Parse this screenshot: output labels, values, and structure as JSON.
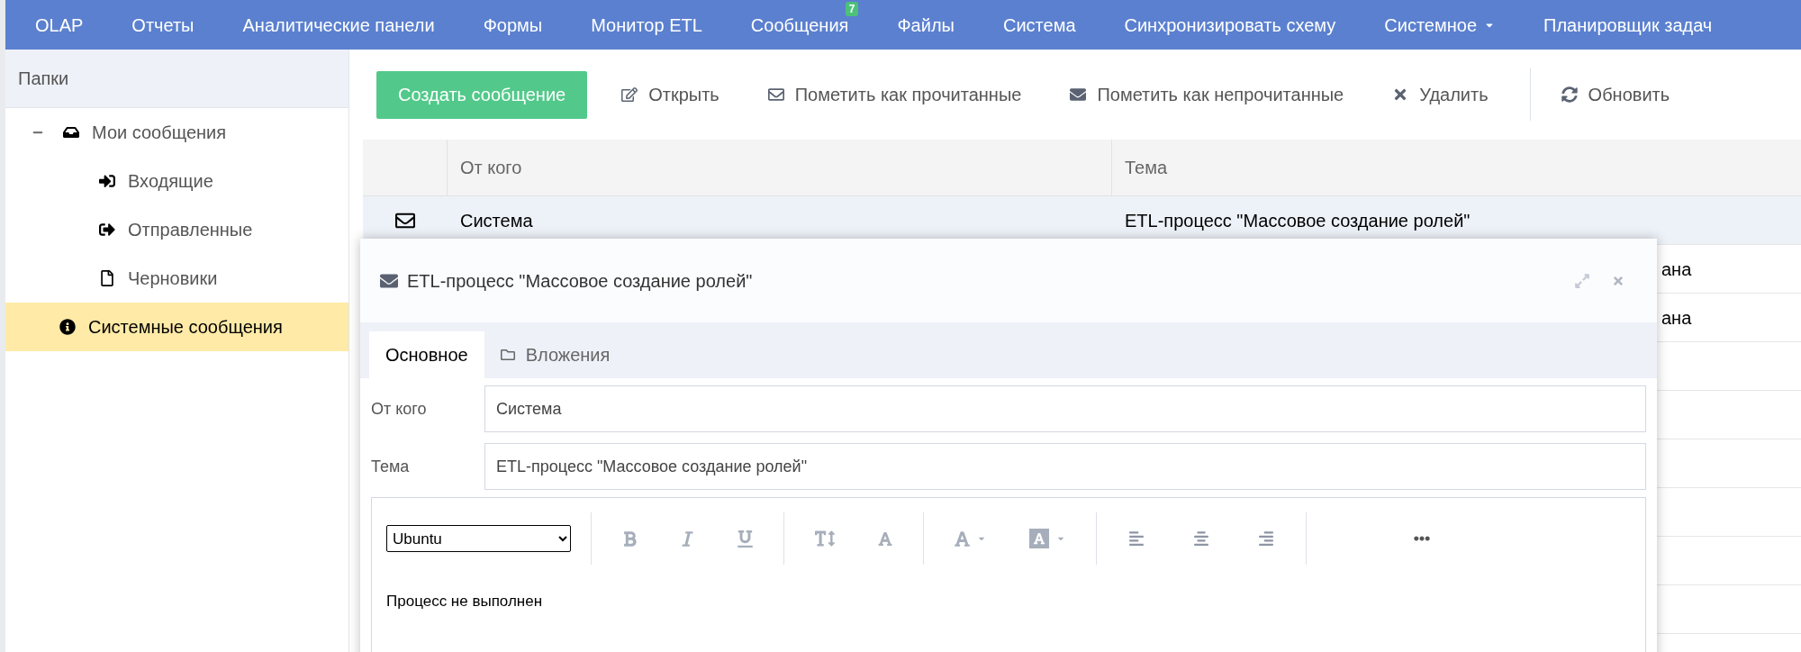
{
  "nav": {
    "items": [
      {
        "label": "OLAP",
        "kind": "link"
      },
      {
        "label": "Отчеты",
        "kind": "link"
      },
      {
        "label": "Аналитические панели",
        "kind": "link"
      },
      {
        "label": "Формы",
        "kind": "link"
      },
      {
        "label": "Монитор ETL",
        "kind": "link"
      },
      {
        "label": "Сообщения",
        "kind": "badge",
        "badge": "7"
      },
      {
        "label": "Файлы",
        "kind": "link"
      },
      {
        "label": "Система",
        "kind": "link"
      },
      {
        "label": "Синхронизировать схему",
        "kind": "link"
      },
      {
        "label": "Системное",
        "kind": "dropdown"
      },
      {
        "label": "Планировщик задач",
        "kind": "link"
      }
    ]
  },
  "sidebar": {
    "title": "Папки",
    "items": [
      {
        "label": "Мои сообщения",
        "kind": "inbox",
        "expanded": true,
        "selected": false,
        "children": [
          {
            "label": "Входящие",
            "kind": "incoming",
            "selected": false
          },
          {
            "label": "Отправленные",
            "kind": "outgoing",
            "selected": false
          },
          {
            "label": "Черновики",
            "kind": "draft",
            "selected": false
          }
        ]
      },
      {
        "label": "Системные сообщения",
        "kind": "info",
        "selected": true
      }
    ]
  },
  "toolbar": {
    "create_button": "Создать сообщение",
    "actions": [
      {
        "label": "Открыть",
        "kind": "edit"
      },
      {
        "label": "Пометить как прочитанные",
        "kind": "read"
      },
      {
        "label": "Пометить как непрочитанные",
        "kind": "unread"
      },
      {
        "label": "Удалить",
        "kind": "delete"
      },
      {
        "label": "Обновить",
        "kind": "refresh"
      }
    ]
  },
  "table": {
    "columns": [
      "От кого",
      "Тема"
    ],
    "rows": [
      {
        "selected": true,
        "from": "Система",
        "subject": "ETL-процесс \"Массовое создание ролей\""
      },
      {
        "selected": false,
        "subject_visible": "ана"
      },
      {
        "selected": false,
        "subject_visible": "ана"
      }
    ]
  },
  "dialog": {
    "title": "ETL-процесс \"Массовое создание ролей\"",
    "tabs": [
      {
        "label": "Основное",
        "selected": true
      },
      {
        "label": "Вложения",
        "selected": false
      }
    ],
    "fields": [
      {
        "label": "От кого",
        "value": "Система"
      },
      {
        "label": "Тема",
        "value": "ETL-процесс \"Массовое создание ролей\""
      }
    ],
    "editor": {
      "font": "Ubuntu",
      "body": "Процесс не выполнен"
    }
  }
}
